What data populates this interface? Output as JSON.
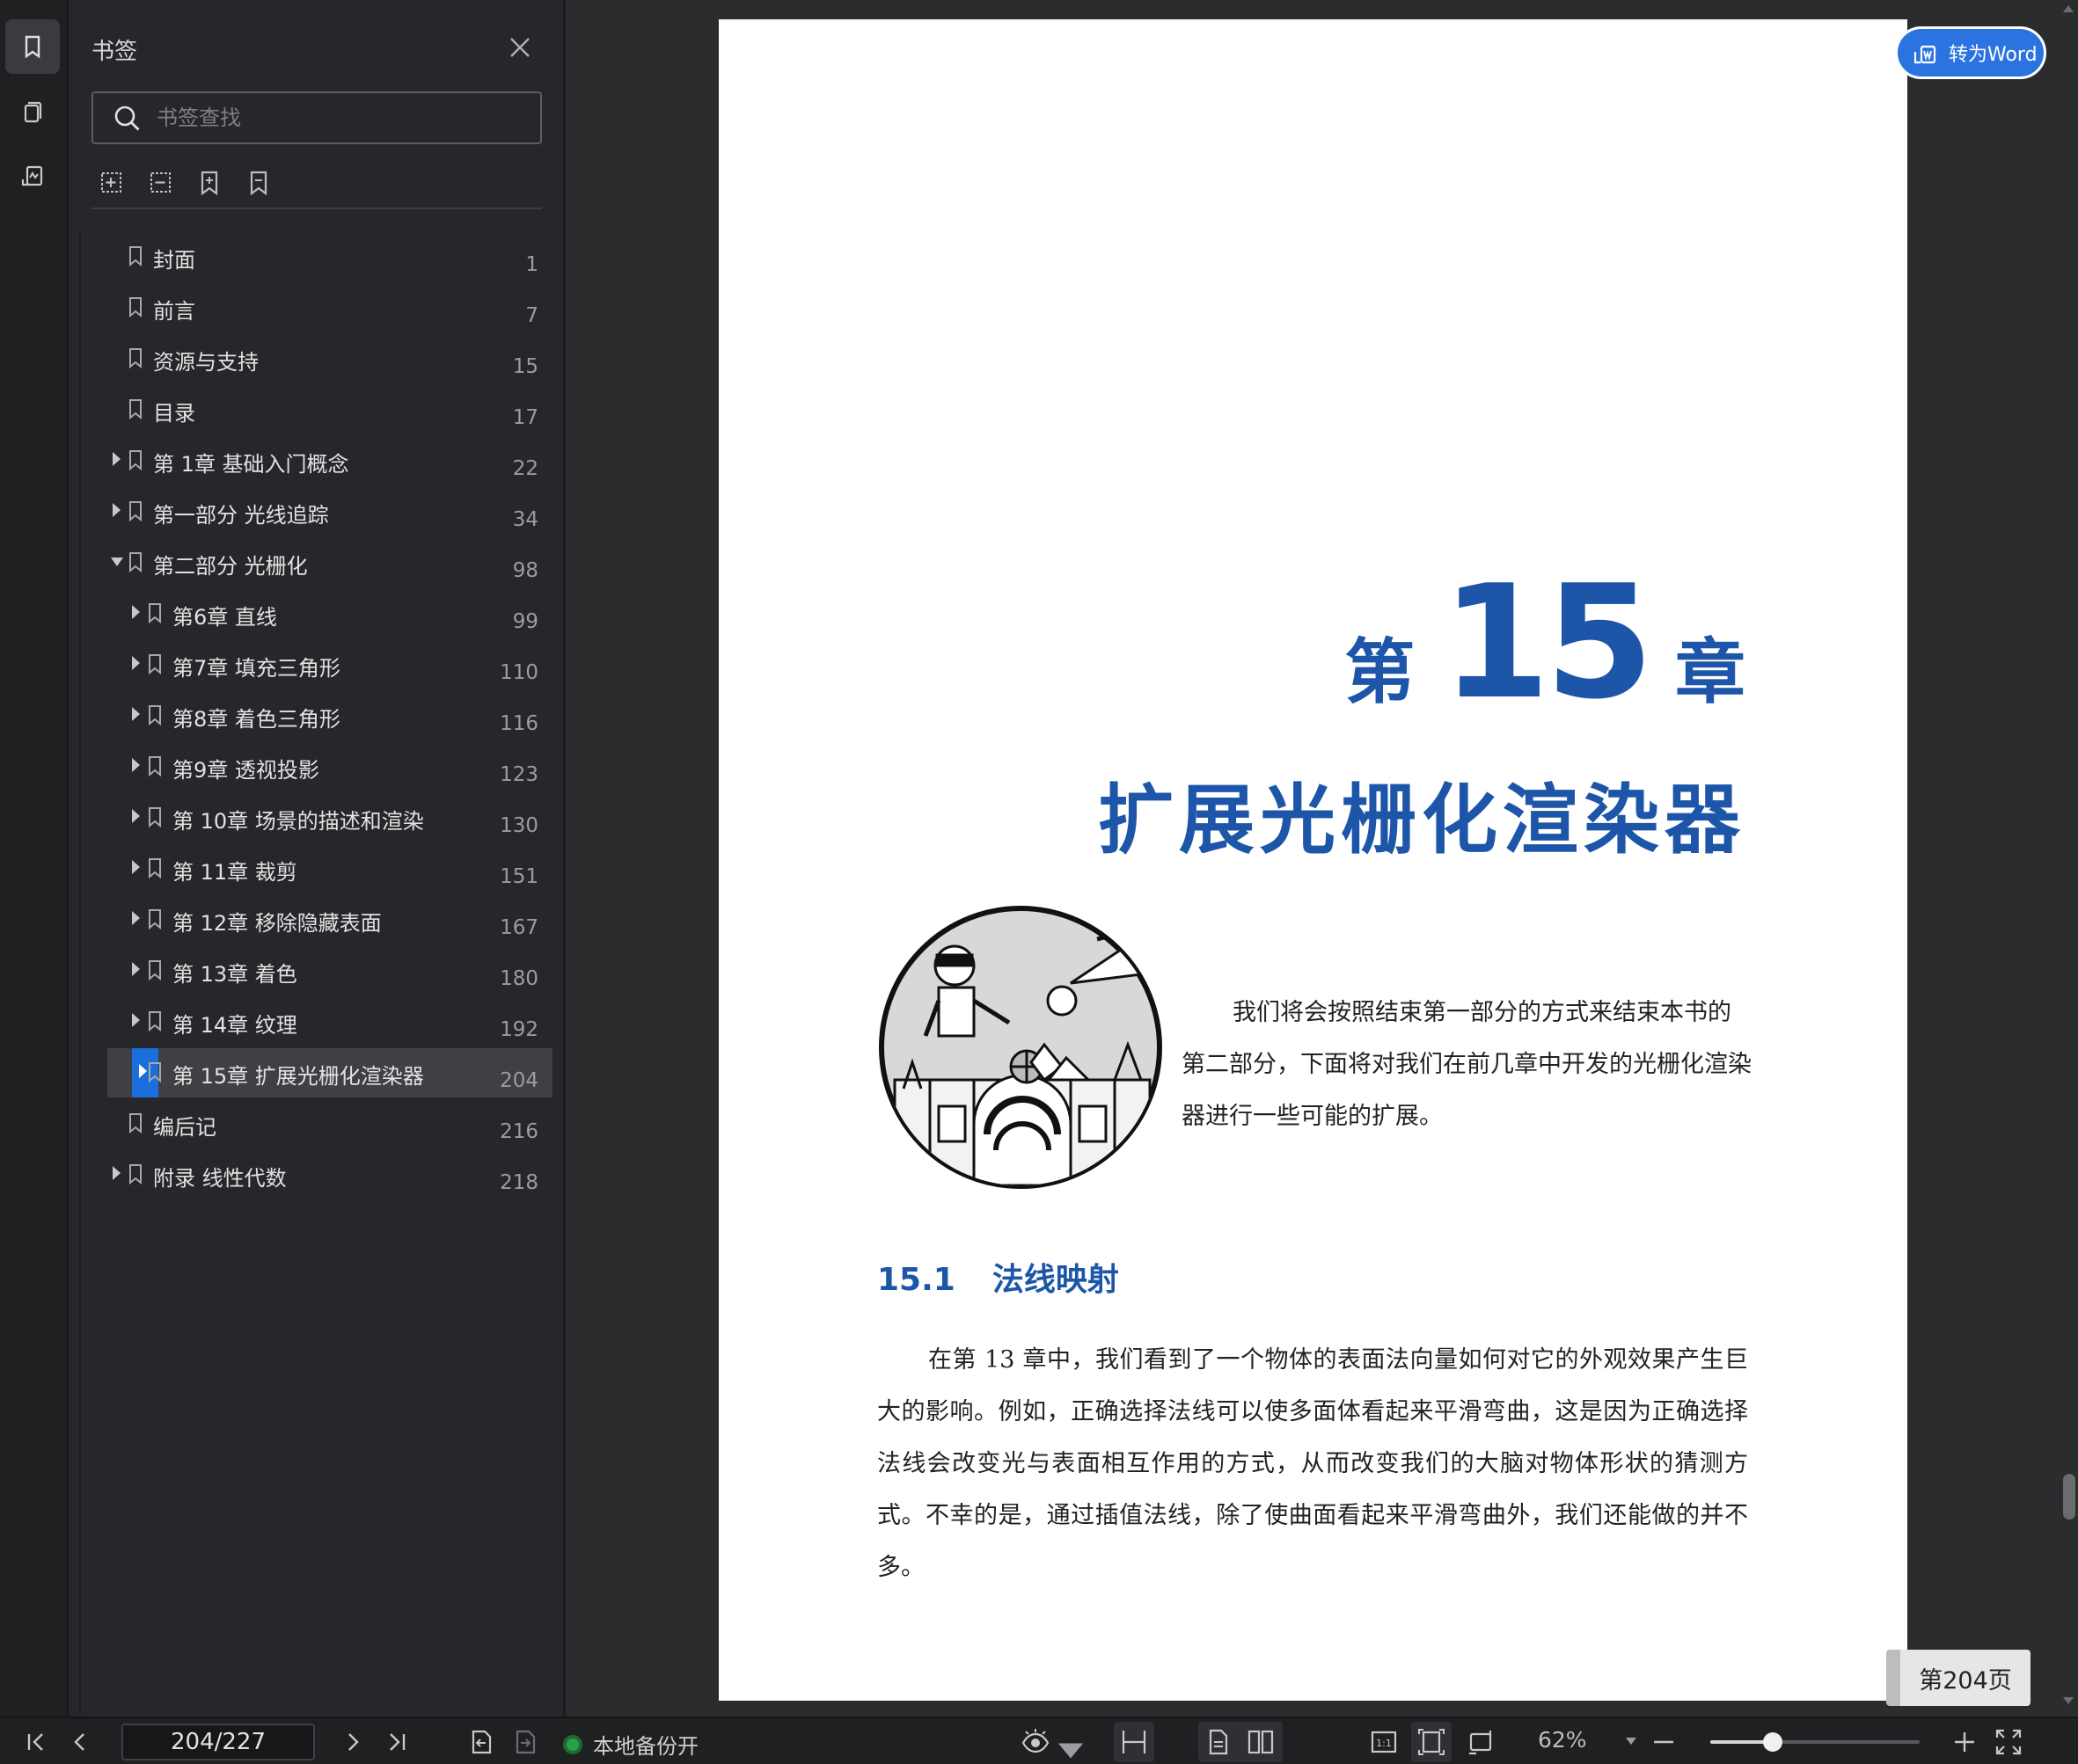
{
  "rail": {
    "items": [
      "bookmark-icon",
      "thumbnail-icon",
      "sign-icon"
    ]
  },
  "panel": {
    "title": "书签",
    "search_placeholder": "书签查找",
    "tools": [
      "expand-all-icon",
      "collapse-all-icon",
      "add-bookmark-icon",
      "remove-bookmark-icon"
    ],
    "items": [
      {
        "label": "封面",
        "page": "1",
        "level": 0,
        "arrow": "none"
      },
      {
        "label": "前言",
        "page": "7",
        "level": 0,
        "arrow": "none"
      },
      {
        "label": "资源与支持",
        "page": "15",
        "level": 0,
        "arrow": "none"
      },
      {
        "label": "目录",
        "page": "17",
        "level": 0,
        "arrow": "none"
      },
      {
        "label": "第 1章 基础入门概念",
        "page": "22",
        "level": 0,
        "arrow": "right"
      },
      {
        "label": "第一部分 光线追踪",
        "page": "34",
        "level": 0,
        "arrow": "right"
      },
      {
        "label": "第二部分 光栅化",
        "page": "98",
        "level": 0,
        "arrow": "down"
      },
      {
        "label": "第6章 直线",
        "page": "99",
        "level": 1,
        "arrow": "right"
      },
      {
        "label": "第7章 填充三角形",
        "page": "110",
        "level": 1,
        "arrow": "right"
      },
      {
        "label": "第8章 着色三角形",
        "page": "116",
        "level": 1,
        "arrow": "right"
      },
      {
        "label": "第9章 透视投影",
        "page": "123",
        "level": 1,
        "arrow": "right"
      },
      {
        "label": "第 10章 场景的描述和渲染",
        "page": "130",
        "level": 1,
        "arrow": "right"
      },
      {
        "label": "第 11章 裁剪",
        "page": "151",
        "level": 1,
        "arrow": "right"
      },
      {
        "label": "第 12章 移除隐藏表面",
        "page": "167",
        "level": 1,
        "arrow": "right"
      },
      {
        "label": "第 13章 着色",
        "page": "180",
        "level": 1,
        "arrow": "right"
      },
      {
        "label": "第 14章 纹理",
        "page": "192",
        "level": 1,
        "arrow": "right"
      },
      {
        "label": "第 15章 扩展光栅化渲染器",
        "page": "204",
        "level": 1,
        "arrow": "right",
        "selected": true
      },
      {
        "label": "编后记",
        "page": "216",
        "level": 0,
        "arrow": "none"
      },
      {
        "label": "附录 线性代数",
        "page": "218",
        "level": 0,
        "arrow": "right"
      }
    ]
  },
  "document": {
    "word_button": "转为Word",
    "chapter_prefix": "第",
    "chapter_number": "15",
    "chapter_suffix": "章",
    "chapter_title": "扩展光栅化渲染器",
    "intro": "我们将会按照结束第一部分的方式来结束本书的第二部分，下面将对我们在前几章中开发的光栅化渲染器进行一些可能的扩展。",
    "section_number": "15.1",
    "section_title": "法线映射",
    "body": "在第 13 章中，我们看到了一个物体的表面法向量如何对它的外观效果产生巨大的影响。例如，正确选择法线可以使多面体看起来平滑弯曲，这是因为正确选择法线会改变光与表面相互作用的方式，从而改变我们的大脑对物体形状的猜测方式。不幸的是，通过插值法线，除了使曲面看起来平滑弯曲外，我们还能做的并不多。",
    "page_badge": "第204页"
  },
  "statusbar": {
    "page_value": "204/227",
    "backup_label": "本地备份开",
    "zoom": "62%",
    "zoom_fraction": 0.3,
    "accent": "#1a6fdc",
    "backup_color": "#27a046"
  }
}
